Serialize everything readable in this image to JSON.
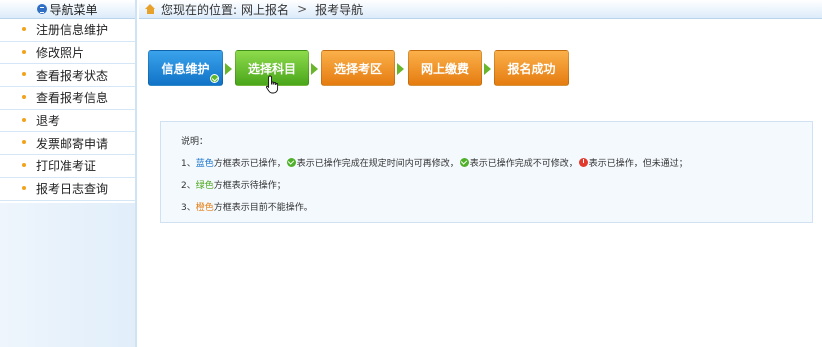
{
  "sidebar": {
    "title": "导航菜单",
    "items": [
      {
        "label": "注册信息维护"
      },
      {
        "label": "修改照片"
      },
      {
        "label": "查看报考状态"
      },
      {
        "label": "查看报考信息"
      },
      {
        "label": "退考"
      },
      {
        "label": "发票邮寄申请"
      },
      {
        "label": "打印准考证"
      },
      {
        "label": "报考日志查询"
      }
    ]
  },
  "breadcrumb": {
    "prefix": "您现在的位置:",
    "level1": "网上报名",
    "separator": ">",
    "level2": "报考导航"
  },
  "steps": [
    {
      "label": "信息维护",
      "color": "blue",
      "completed": true
    },
    {
      "label": "选择科目",
      "color": "green",
      "completed": false
    },
    {
      "label": "选择考区",
      "color": "orange",
      "completed": false
    },
    {
      "label": "网上缴费",
      "color": "orange",
      "completed": false
    },
    {
      "label": "报名成功",
      "color": "orange",
      "completed": false
    }
  ],
  "notes": {
    "heading": "说明：",
    "line1": {
      "num": "1、",
      "colorword": "蓝色",
      "text_a": "方框表示已操作，",
      "text_b": "表示已操作完成在规定时间内可再修改，",
      "text_c": "表示已操作完成不可修改，",
      "text_d": "表示已操作，但未通过；"
    },
    "line2": {
      "num": "2、",
      "colorword": "绿色",
      "text": "方框表示待操作；"
    },
    "line3": {
      "num": "3、",
      "colorword": "橙色",
      "text": "方框表示目前不能操作。"
    }
  },
  "colors": {
    "blue": "#1173c7",
    "green": "#4aa61a",
    "orange": "#e57c10",
    "accent": "#f2a31b"
  }
}
